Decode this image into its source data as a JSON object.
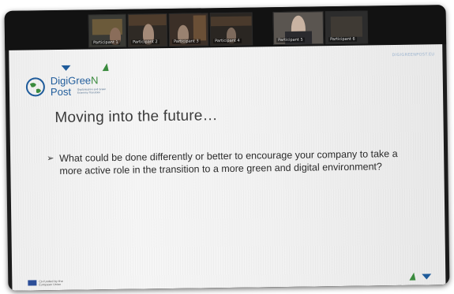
{
  "meeting": {
    "participants": [
      {
        "name": "Participant 1"
      },
      {
        "name": "Participant 2"
      },
      {
        "name": "Participant 3"
      },
      {
        "name": "Participant 4"
      },
      {
        "name": "Participant 5"
      },
      {
        "name": "Participant 6"
      }
    ]
  },
  "slide": {
    "logo": {
      "line1_a": "DigiGree",
      "line1_b": "N",
      "line2": "Post",
      "tagline": "Digitalisation and Green Economy Transition"
    },
    "corner_text": "DIGIGREENPOST.EU",
    "title": "Moving into the future…",
    "bullet_marker": "➢",
    "bullet_text": "What could be done differently or better to encourage your company to take a more active role in the transition to a more green and digital environment?",
    "footer_text": "Co-funded by the European Union"
  },
  "colors": {
    "brand_blue": "#1f5c9c",
    "brand_green": "#3b8c3e",
    "slide_bg": "#f2f2f2",
    "title_text": "#3b3b3b"
  }
}
